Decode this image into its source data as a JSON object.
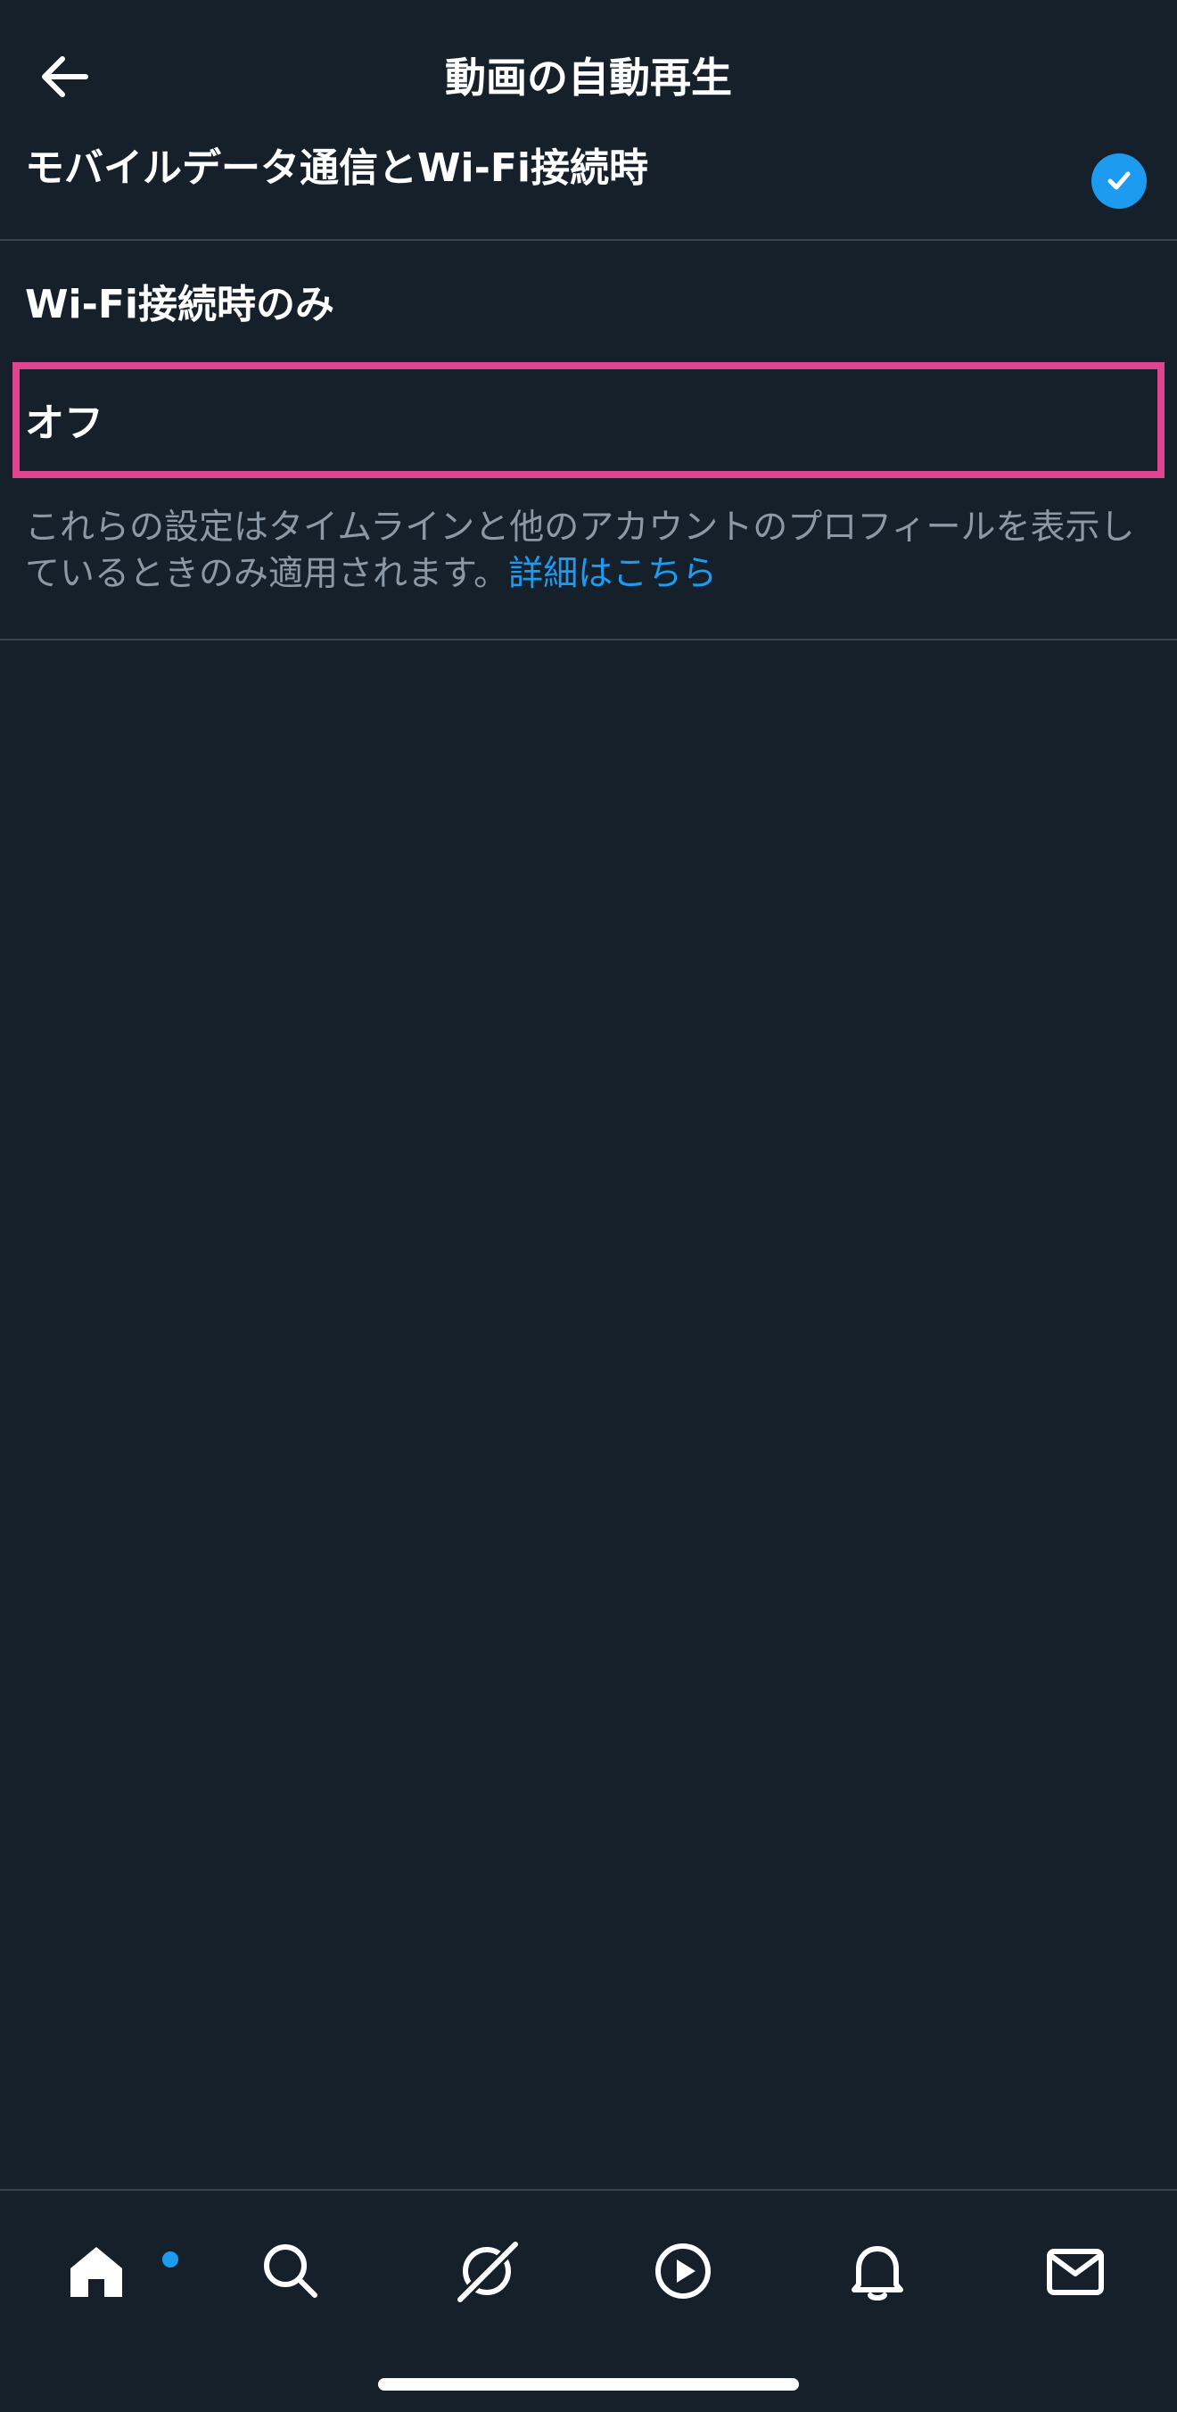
{
  "header": {
    "title": "動画の自動再生"
  },
  "options": [
    {
      "label": "モバイルデータ通信とWi-Fi接続時",
      "selected": true
    },
    {
      "label": "Wi-Fi接続時のみ",
      "selected": false
    },
    {
      "label": "オフ",
      "selected": false
    }
  ],
  "note": {
    "text": "これらの設定はタイムラインと他のアカウントのプロフィールを表示しているときのみ適用されます。",
    "link": "詳細はこちら"
  },
  "tabs": [
    {
      "icon": "home-icon"
    },
    {
      "icon": "search-icon"
    },
    {
      "icon": "grok-icon"
    },
    {
      "icon": "video-icon"
    },
    {
      "icon": "bell-icon"
    },
    {
      "icon": "mail-icon"
    }
  ],
  "colors": {
    "background": "#15202b",
    "accent": "#1d9bf0",
    "highlight": "#e0468f",
    "divider": "#38444d",
    "secondary_text": "#8b98a5"
  }
}
